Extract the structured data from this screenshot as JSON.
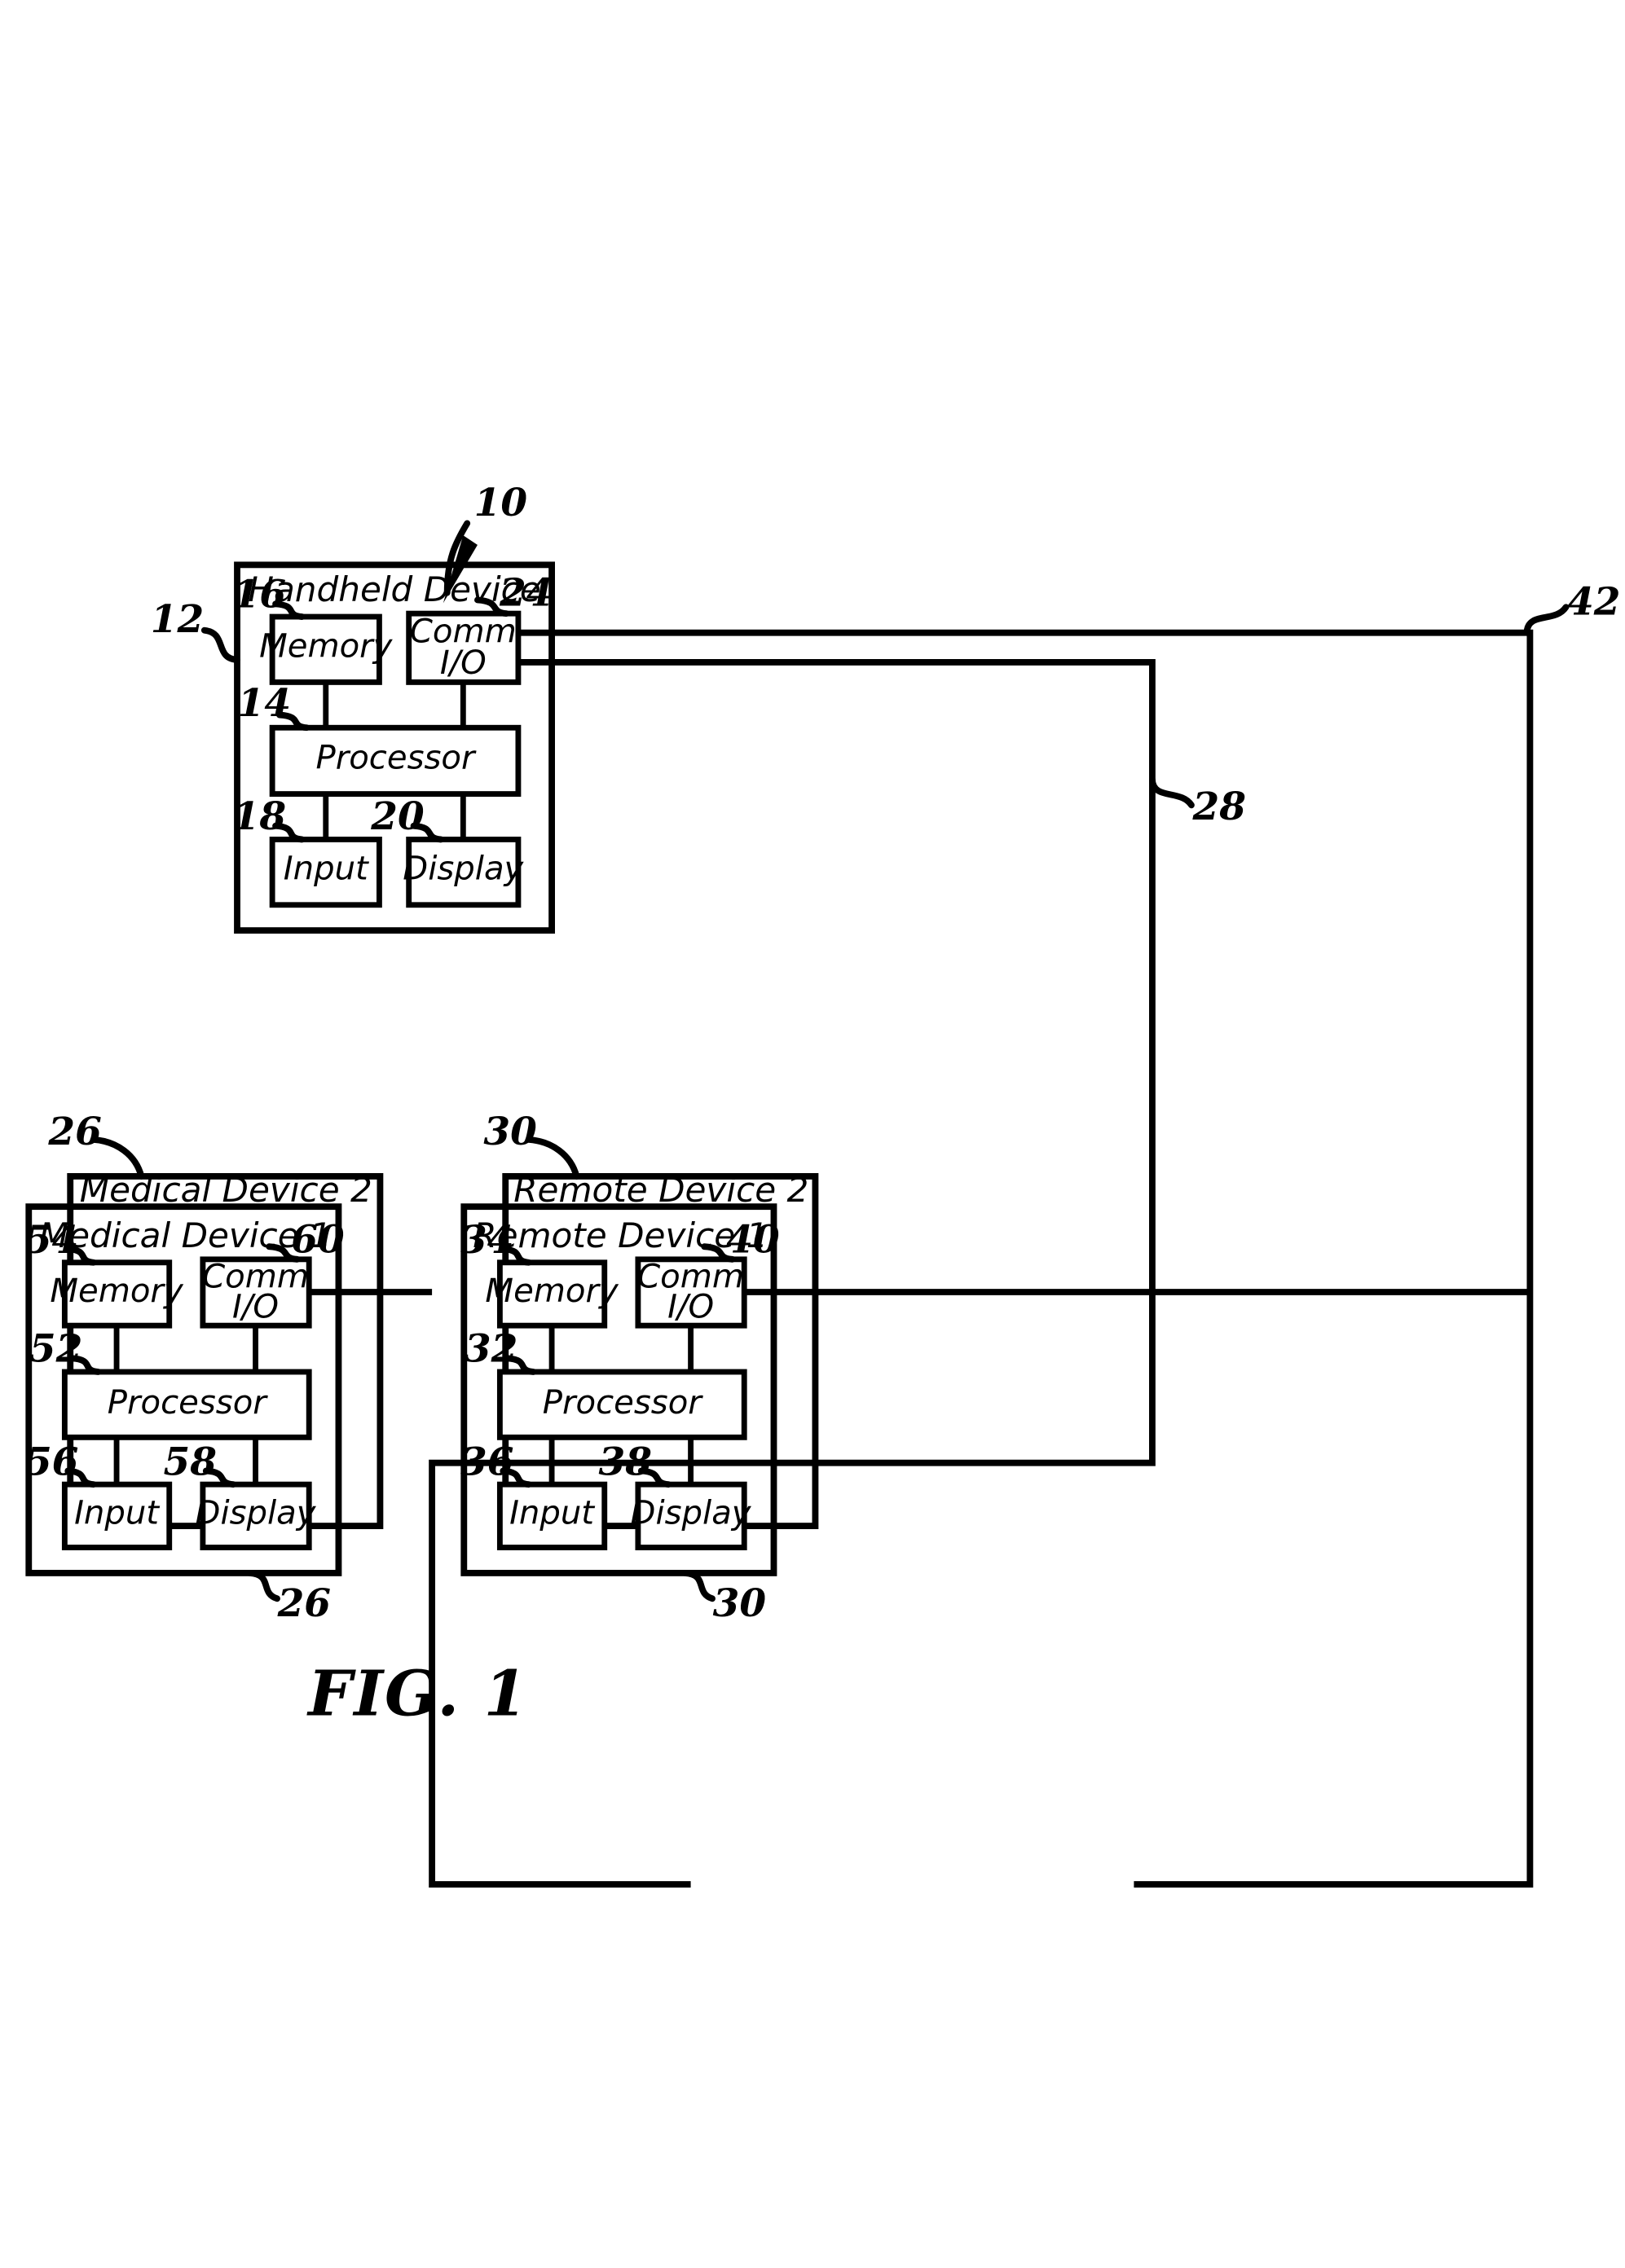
{
  "figure": {
    "caption": "FIG. 1",
    "system_ref": "10"
  },
  "handheld": {
    "title": "Handheld Device",
    "ref": "12",
    "blocks": {
      "memory": {
        "label": "Memory",
        "ref": "16"
      },
      "comm_io": {
        "label": "Comm\nI/O",
        "label_line1": "Comm",
        "label_line2": "I/O",
        "ref": "24"
      },
      "processor": {
        "label": "Processor",
        "ref": "14"
      },
      "input": {
        "label": "Input",
        "ref": "18"
      },
      "display": {
        "label": "Display",
        "ref": "20"
      }
    }
  },
  "medical": {
    "outer_title": "Medical Device 2",
    "outer_ref_top": "26",
    "outer_ref_bottom": "26",
    "inner_title": "Medical Device 1",
    "blocks": {
      "memory": {
        "label": "Memory",
        "ref": "54"
      },
      "comm_io": {
        "label_line1": "Comm",
        "label_line2": "I/O",
        "ref": "60"
      },
      "processor": {
        "label": "Processor",
        "ref": "52"
      },
      "input": {
        "label": "Input",
        "ref": "56"
      },
      "display": {
        "label": "Display",
        "ref": "58"
      }
    }
  },
  "remote": {
    "outer_title": "Remote Device 2",
    "outer_ref_top": "30",
    "outer_ref_bottom": "30",
    "inner_title": "Remote Device 1",
    "blocks": {
      "memory": {
        "label": "Memory",
        "ref": "34"
      },
      "comm_io": {
        "label_line1": "Comm",
        "label_line2": "I/O",
        "ref": "40"
      },
      "processor": {
        "label": "Processor",
        "ref": "32"
      },
      "input": {
        "label": "Input",
        "ref": "36"
      },
      "display": {
        "label": "Display",
        "ref": "38"
      }
    }
  },
  "links": {
    "medical_link_ref": "28",
    "remote_link_ref": "42"
  },
  "colors": {
    "ink": "#000000",
    "paper": "#ffffff"
  }
}
